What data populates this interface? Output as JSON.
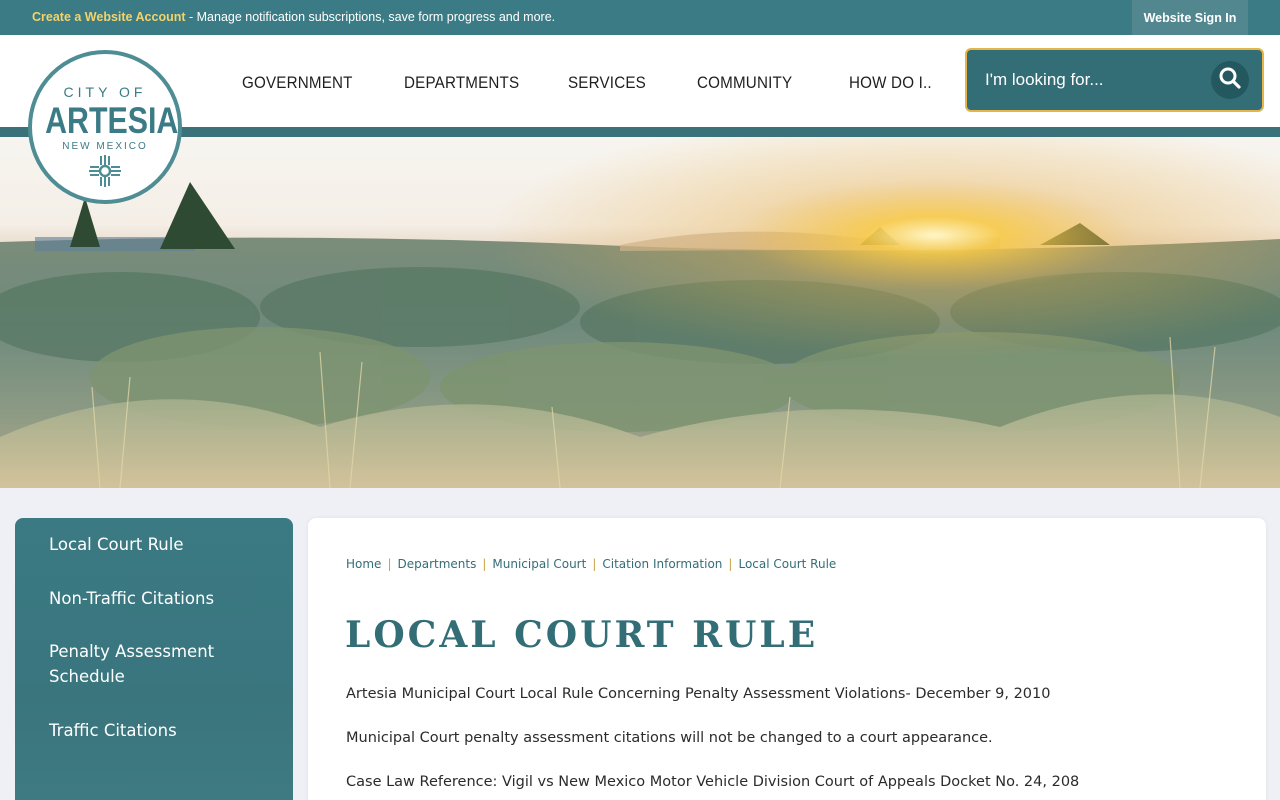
{
  "topbar": {
    "account_link": "Create a Website Account",
    "message": " - Manage notification subscriptions, save form progress and more.",
    "signin_label": "Website Sign In"
  },
  "logo": {
    "city_of": "CITY OF",
    "name": "ARTESIA",
    "state": "NEW MEXICO"
  },
  "nav": {
    "items": [
      "GOVERNMENT",
      "DEPARTMENTS",
      "SERVICES",
      "COMMUNITY",
      "HOW DO I.."
    ]
  },
  "search": {
    "placeholder": "I'm looking for..."
  },
  "sidebar": {
    "items": [
      "Local Court Rule",
      "Non-Traffic Citations",
      "Penalty Assessment Schedule",
      "Traffic Citations"
    ]
  },
  "breadcrumb": [
    "Home",
    "Departments",
    "Municipal Court",
    "Citation Information",
    "Local Court Rule"
  ],
  "content": {
    "title": "LOCAL COURT RULE",
    "paragraphs": [
      "Artesia Municipal Court Local Rule Concerning Penalty Assessment Violations- December 9, 2010",
      "Municipal Court penalty assessment citations will not be changed to a court appearance.",
      "Case Law Reference: Vigil vs New Mexico Motor Vehicle Division Court of Appeals Docket No. 24, 208"
    ]
  },
  "colors": {
    "teal": "#3b7b85",
    "dark_teal": "#336e77",
    "gold": "#e3b54a",
    "link_yellow": "#f3d36a"
  },
  "icons": {
    "search": "search-icon",
    "logo_symbol": "zia-sun-icon"
  }
}
